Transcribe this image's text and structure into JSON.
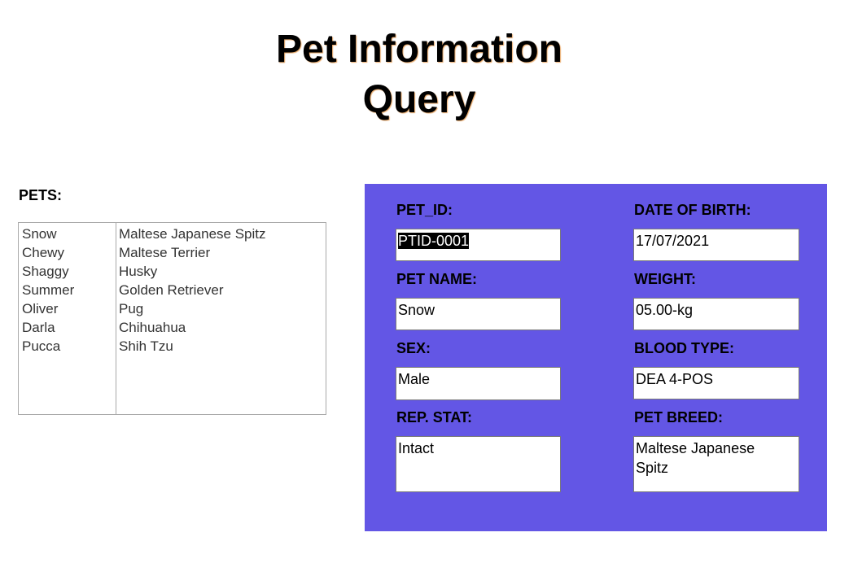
{
  "title": {
    "line1": "Pet Information",
    "line2": "Query"
  },
  "pets_label": "PETS:",
  "pets": [
    {
      "name": "Snow",
      "breed": "Maltese Japanese Spitz"
    },
    {
      "name": "Chewy",
      "breed": "Maltese Terrier"
    },
    {
      "name": "Shaggy",
      "breed": "Husky"
    },
    {
      "name": "Summer",
      "breed": "Golden Retriever"
    },
    {
      "name": "Oliver",
      "breed": "Pug"
    },
    {
      "name": "Darla",
      "breed": "Chihuahua"
    },
    {
      "name": "Pucca",
      "breed": "Shih Tzu"
    }
  ],
  "form": {
    "pet_id": {
      "label": "PET_ID:",
      "value": "PTID-0001"
    },
    "dob": {
      "label": "DATE OF BIRTH:",
      "value": "17/07/2021"
    },
    "pet_name": {
      "label": "PET NAME:",
      "value": "Snow"
    },
    "weight": {
      "label": "WEIGHT:",
      "value": "05.00-kg"
    },
    "sex": {
      "label": "SEX:",
      "value": "Male"
    },
    "blood_type": {
      "label": "BLOOD TYPE:",
      "value": "DEA 4-POS"
    },
    "rep_stat": {
      "label": "REP. STAT:",
      "value": "Intact"
    },
    "pet_breed": {
      "label": "PET BREED:",
      "value": "Maltese Japanese\nSpitz"
    }
  },
  "colors": {
    "panel": "#6356e5",
    "title_shadow": "#e8a766"
  }
}
